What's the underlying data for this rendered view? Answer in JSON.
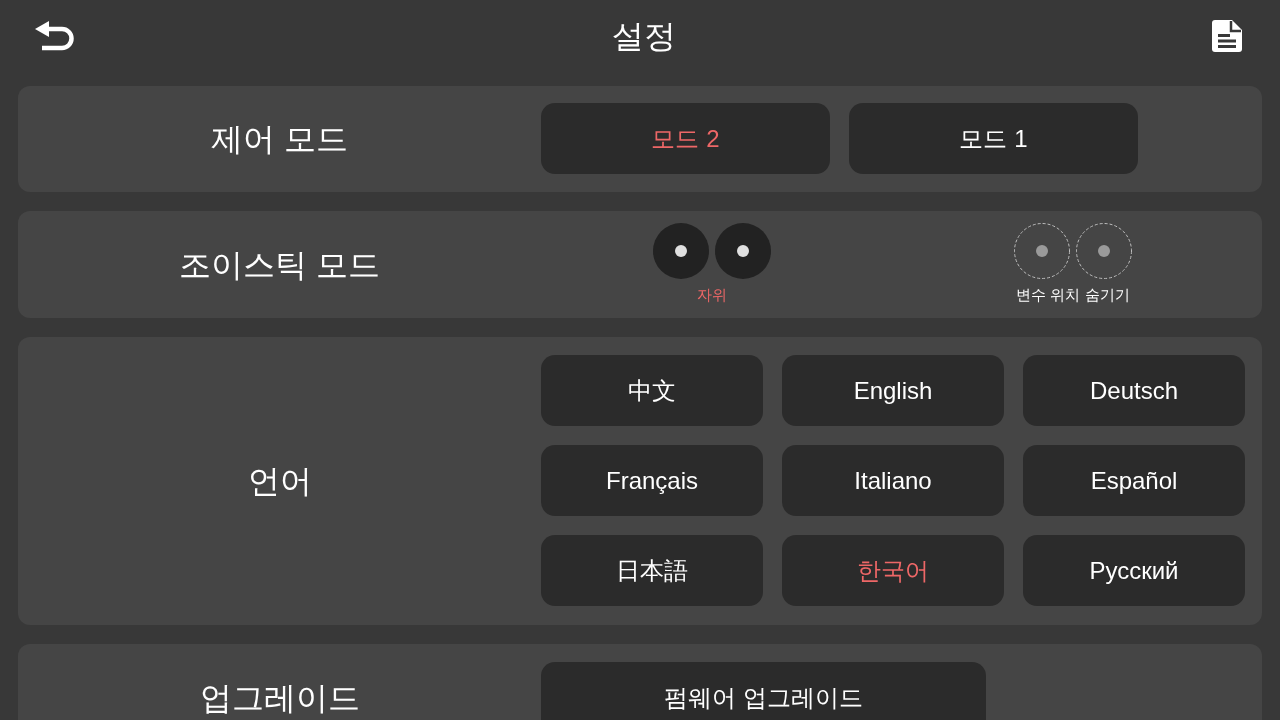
{
  "header": {
    "title": "설정"
  },
  "sections": [
    {
      "kind": "segmented",
      "label": "제어 모드",
      "options": [
        {
          "label": "모드 2",
          "selected": true
        },
        {
          "label": "모드 1",
          "selected": false
        }
      ]
    },
    {
      "kind": "joystick",
      "label": "조이스틱 모드",
      "options": [
        {
          "label": "자위",
          "kind": "solid",
          "selected": true
        },
        {
          "label": "변수 위치 숨기기",
          "kind": "dashed",
          "selected": false
        }
      ]
    },
    {
      "kind": "grid",
      "label": "언어",
      "options": [
        {
          "label": "中文",
          "selected": false
        },
        {
          "label": "English",
          "selected": false
        },
        {
          "label": "Deutsch",
          "selected": false
        },
        {
          "label": "Français",
          "selected": false
        },
        {
          "label": "Italiano",
          "selected": false
        },
        {
          "label": "Español",
          "selected": false
        },
        {
          "label": "日本語",
          "selected": false
        },
        {
          "label": "한국어",
          "selected": true
        },
        {
          "label": "Русский",
          "selected": false
        }
      ]
    },
    {
      "kind": "action",
      "label": "업그레이드",
      "buttons": [
        {
          "label": "펌웨어 업그레이드"
        }
      ]
    }
  ]
}
